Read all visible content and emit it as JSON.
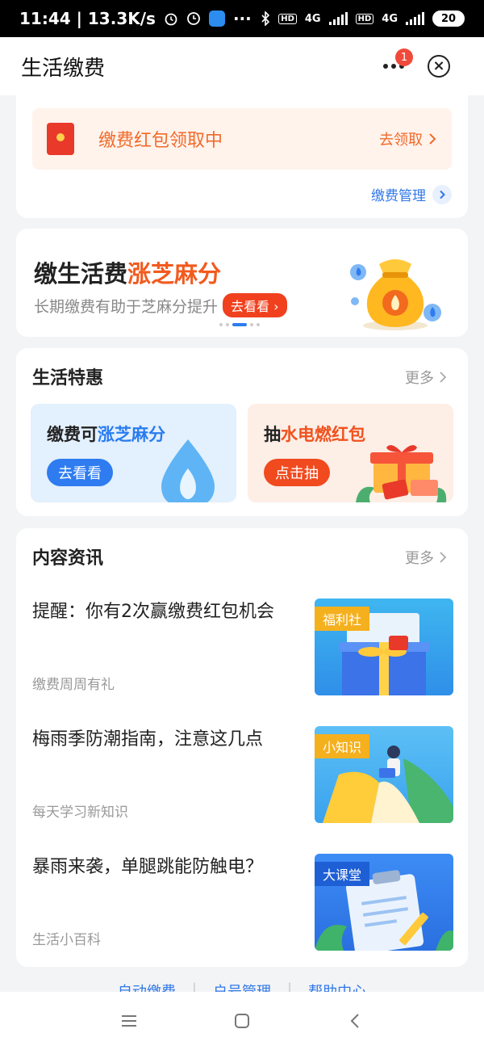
{
  "status_bar": {
    "time_speed": "11:44 | 13.3K/s",
    "hd": "HD",
    "network": "4G",
    "battery": "20"
  },
  "nav": {
    "title": "生活缴费",
    "notification_count": "1"
  },
  "payment_card": {
    "promo_text": "缴费红包领取中",
    "promo_action": "去领取",
    "manage_link": "缴费管理"
  },
  "banner": {
    "title_plain": "缴生活费",
    "title_highlight": "涨芝麻分",
    "subtitle": "长期缴费有助于芝麻分提升",
    "button": "去看看",
    "active_slide": 3,
    "slide_count": 5
  },
  "life_specials": {
    "title": "生活特惠",
    "more": "更多",
    "tiles": [
      {
        "text_plain": "缴费可",
        "text_highlight": "涨芝麻分",
        "button": "去看看"
      },
      {
        "text_plain": "抽",
        "text_highlight": "水电燃红包",
        "button": "点击抽"
      }
    ]
  },
  "news": {
    "title": "内容资讯",
    "more": "更多",
    "items": [
      {
        "title": "提醒：你有2次赢缴费红包机会",
        "source": "缴费周周有礼",
        "tag": "福利社"
      },
      {
        "title": "梅雨季防潮指南，注意这几点",
        "source": "每天学习新知识",
        "tag": "小知识"
      },
      {
        "title": "暴雨来袭，单腿跳能防触电？",
        "source": "生活小百科",
        "tag": "大课堂"
      }
    ]
  },
  "footer_links": [
    "自动缴费",
    "户号管理",
    "帮助中心"
  ],
  "colors": {
    "accent_blue": "#2e7cf0",
    "accent_orange": "#f25a1e",
    "notification_red": "#f04a3a"
  }
}
